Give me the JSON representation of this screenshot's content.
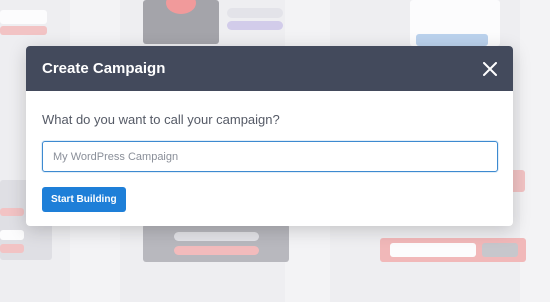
{
  "modal": {
    "title": "Create Campaign",
    "prompt": "What do you want to call your campaign?",
    "input_value": "",
    "input_placeholder": "My WordPress Campaign",
    "start_button_label": "Start Building",
    "close_icon": "close-icon"
  },
  "colors": {
    "header_bg": "#434a5c",
    "primary_button": "#1e7fd8",
    "input_focus_border": "#3d8ad0"
  }
}
